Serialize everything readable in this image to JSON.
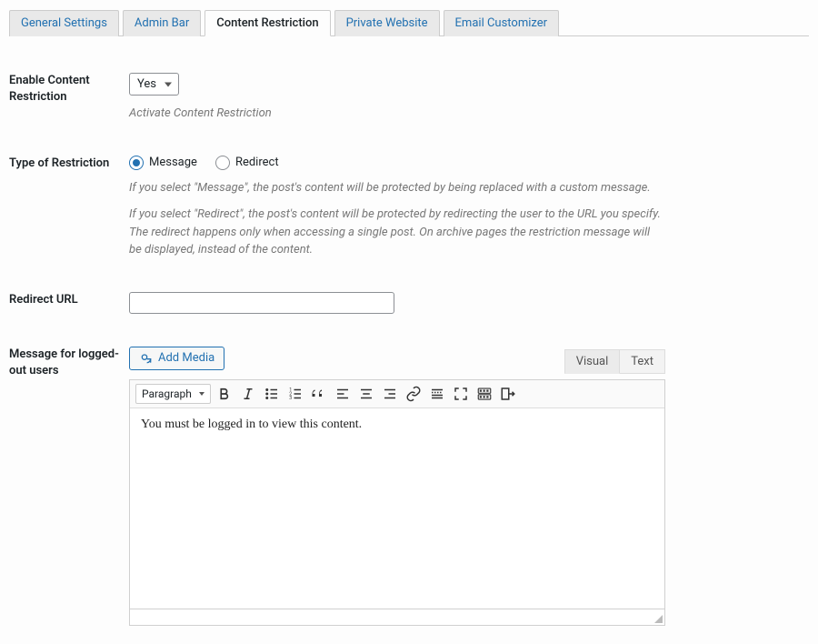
{
  "tabs": [
    "General Settings",
    "Admin Bar",
    "Content Restriction",
    "Private Website",
    "Email Customizer"
  ],
  "active_tab": 2,
  "fields": {
    "enable": {
      "label": "Enable Content Restriction",
      "value": "Yes",
      "helper": "Activate Content Restriction"
    },
    "type": {
      "label": "Type of Restriction",
      "options": [
        "Message",
        "Redirect"
      ],
      "selected": 0,
      "helper1": "If you select \"Message\", the post's content will be protected by being replaced with a custom message.",
      "helper2": "If you select \"Redirect\", the post's content will be protected by redirecting the user to the URL you specify. The redirect happens only when accessing a single post. On archive pages the restriction message will be displayed, instead of the content."
    },
    "redirect_url": {
      "label": "Redirect URL",
      "value": ""
    },
    "message": {
      "label": "Message for logged-out users",
      "add_media": "Add Media",
      "editor_tabs": [
        "Visual",
        "Text"
      ],
      "format_select": "Paragraph",
      "content": "You must be logged in to view this content."
    }
  }
}
